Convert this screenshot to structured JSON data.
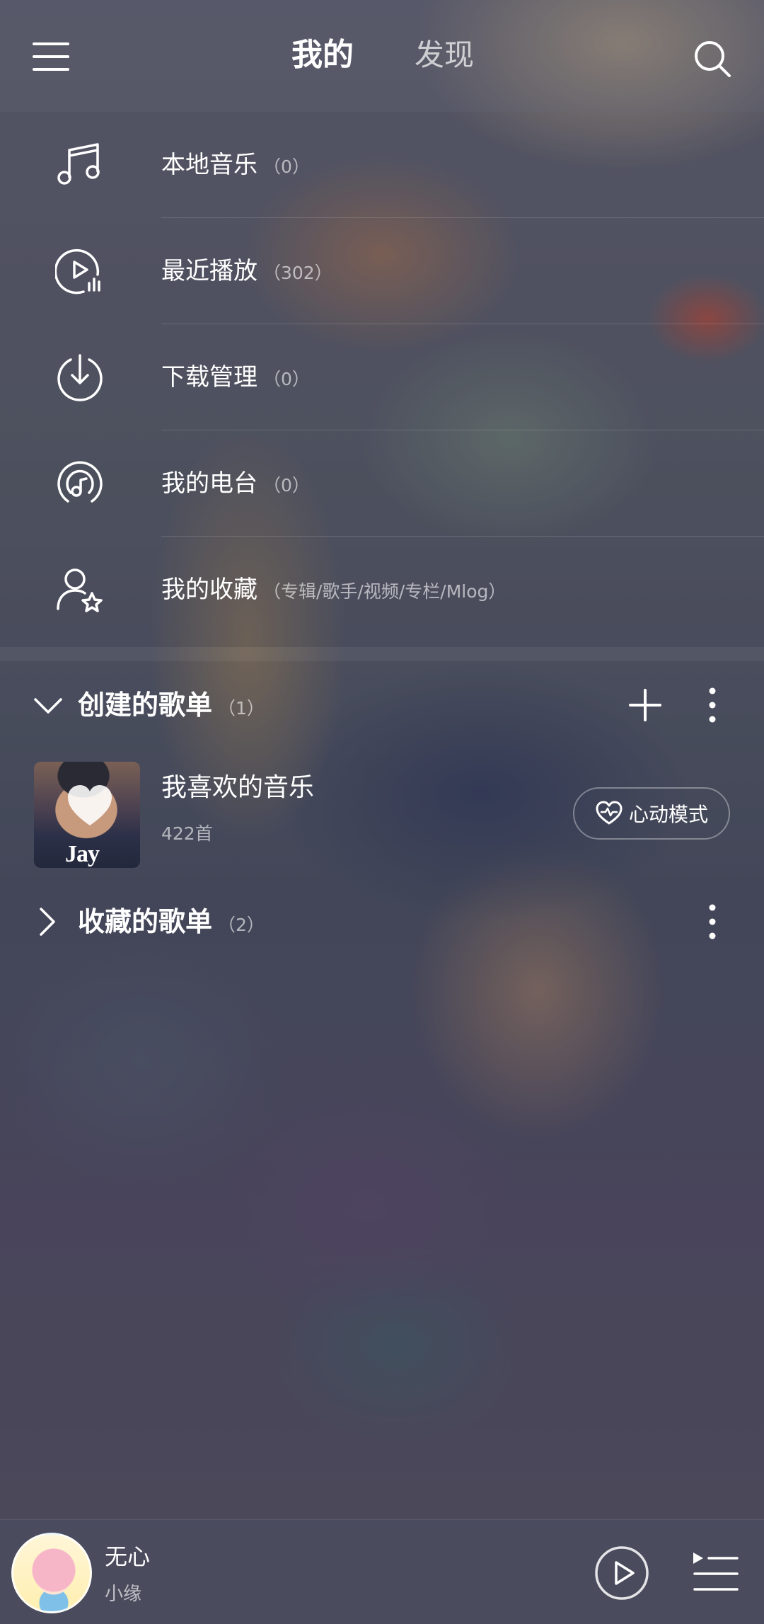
{
  "header": {
    "tabs": [
      {
        "label": "我的"
      },
      {
        "label": "发现"
      }
    ]
  },
  "menu": {
    "items": [
      {
        "label": "本地音乐",
        "count": "（0）",
        "icon": "music-note-icon"
      },
      {
        "label": "最近播放",
        "count": "（302）",
        "icon": "recent-play-icon"
      },
      {
        "label": "下载管理",
        "count": "（0）",
        "icon": "download-icon"
      },
      {
        "label": "我的电台",
        "count": "（0）",
        "icon": "radio-icon"
      },
      {
        "label": "我的收藏",
        "count": "（专辑/歌手/视频/专栏/Mlog）",
        "icon": "user-star-icon"
      }
    ]
  },
  "created_playlists": {
    "title": "创建的歌单",
    "count": "（1）",
    "items": [
      {
        "name": "我喜欢的音乐",
        "subtitle": "422首",
        "cover_text": "Jay",
        "action_label": "心动模式"
      }
    ]
  },
  "collected_playlists": {
    "title": "收藏的歌单",
    "count": "（2）"
  },
  "player": {
    "song": "无心",
    "artist": "小缘"
  },
  "colors": {
    "text": "#ffffff",
    "muted_text": "#ffffff99"
  }
}
